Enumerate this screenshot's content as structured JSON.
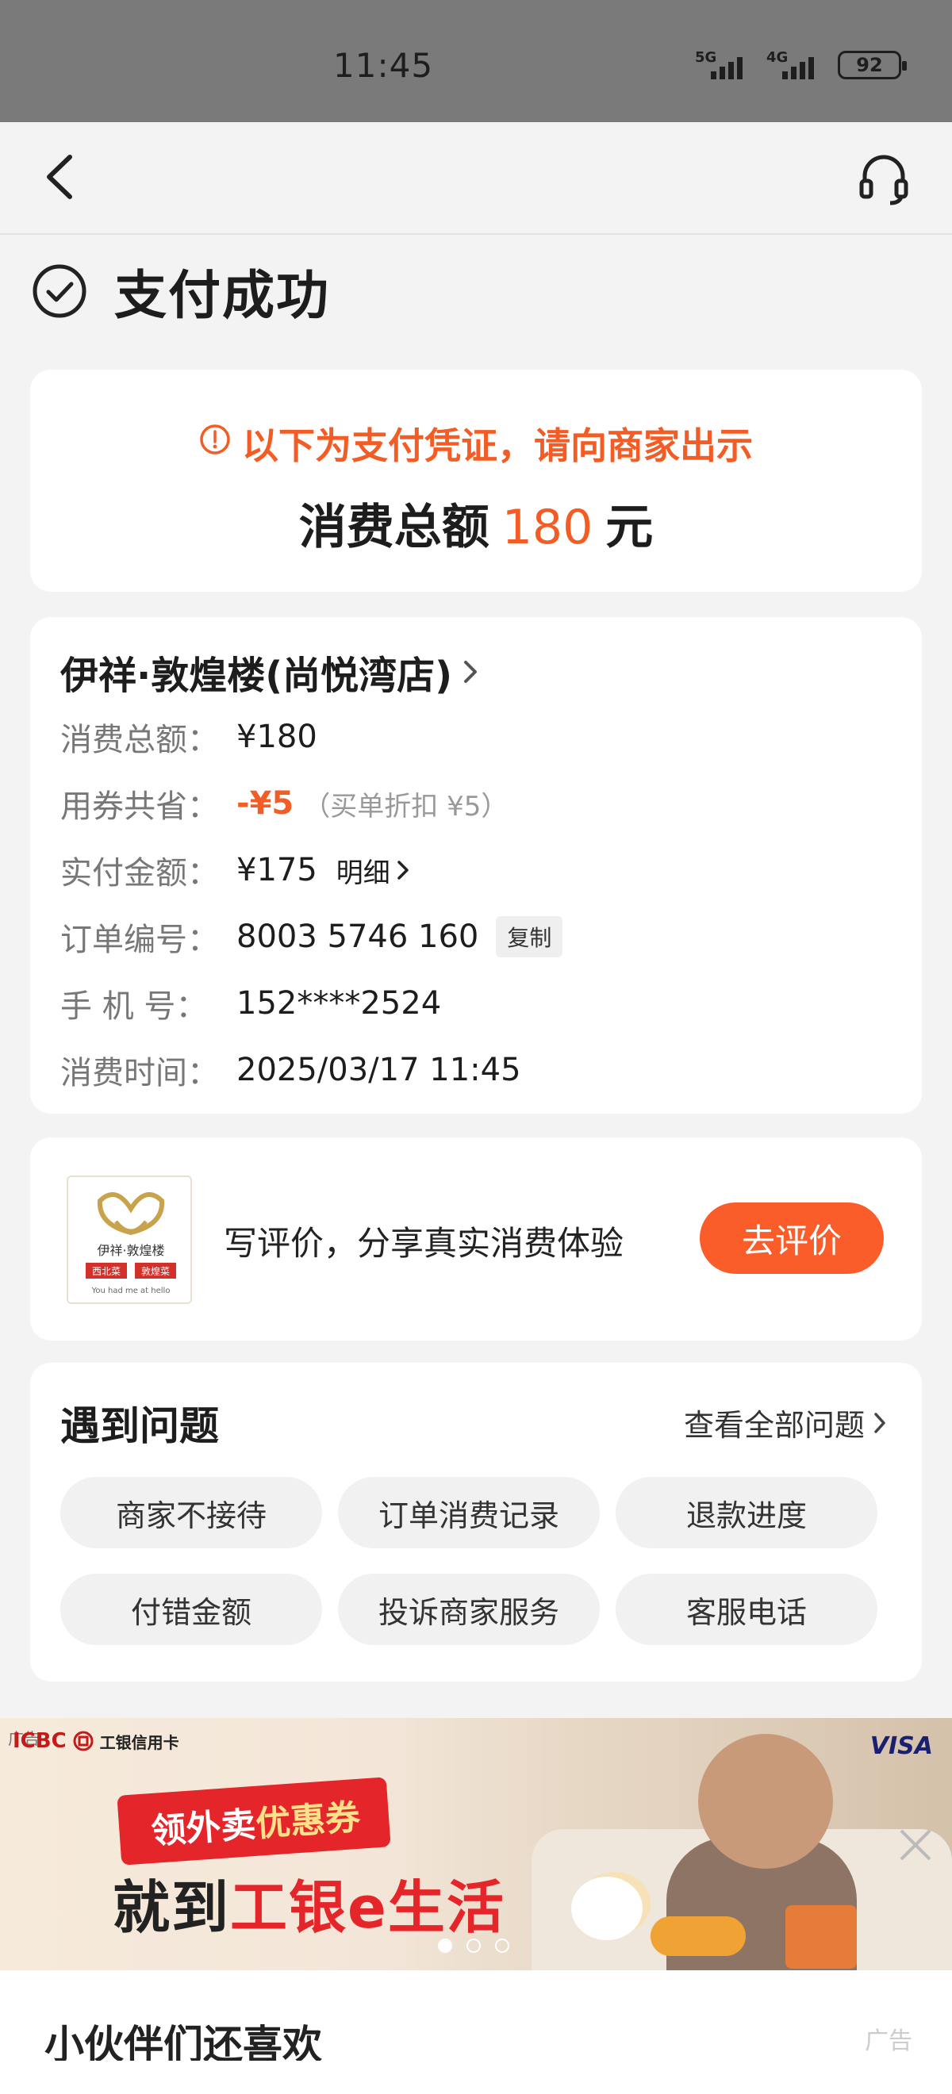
{
  "status_bar": {
    "time": "11:45",
    "net1": "5G",
    "net2": "4G",
    "battery": "92"
  },
  "nav": {
    "back_icon": "chevron-left-icon",
    "service_icon": "headset-icon"
  },
  "status_title": "支付成功",
  "voucher_card": {
    "notice": "以下为支付凭证，请向商家出示",
    "total_label": "消费总额",
    "total_amount": "180",
    "total_unit": "元"
  },
  "order": {
    "shop_name": "伊祥·敦煌楼(尚悦湾店)",
    "rows": {
      "total": {
        "label": "消费总额：",
        "value": "¥180"
      },
      "saved": {
        "label": "用券共省：",
        "value": "-¥5",
        "note": "（买单折扣 ¥5）"
      },
      "paid": {
        "label": "实付金额：",
        "value": "¥175",
        "link": "明细"
      },
      "order_no": {
        "label": "订单编号：",
        "value": "8003 5746 160",
        "copy": "复制"
      },
      "phone": {
        "label": "手 机 号：",
        "value": "152****2524"
      },
      "time": {
        "label": "消费时间：",
        "value": "2025/03/17 11:45"
      }
    }
  },
  "review": {
    "logo_text": "伊祥·敦煌楼",
    "logo_tags": [
      "西北菜",
      "敦煌菜"
    ],
    "logo_slogan": "You had me at hello",
    "text": "写评价，分享真实消费体验",
    "button": "去评价"
  },
  "problems": {
    "title": "遇到问题",
    "view_all": "查看全部问题",
    "chips": [
      "商家不接待",
      "订单消费记录",
      "退款进度",
      "付错金额",
      "投诉商家服务",
      "客服电话"
    ]
  },
  "banner": {
    "ad_tag": "广告",
    "bank": "ICBC",
    "bank_sub": "工银信用卡",
    "card_brand": "VISA",
    "tag_part1": "领外卖",
    "tag_part2": "优惠券",
    "headline_part1": "就到",
    "headline_part2": "工银e生活",
    "slide_index": 1,
    "slide_count": 3
  },
  "recommend": {
    "title": "小伙伴们还喜欢",
    "ad_label": "广告"
  },
  "colors": {
    "accent": "#f35d25",
    "button": "#fb5d2a",
    "background": "#f3f3f3"
  }
}
